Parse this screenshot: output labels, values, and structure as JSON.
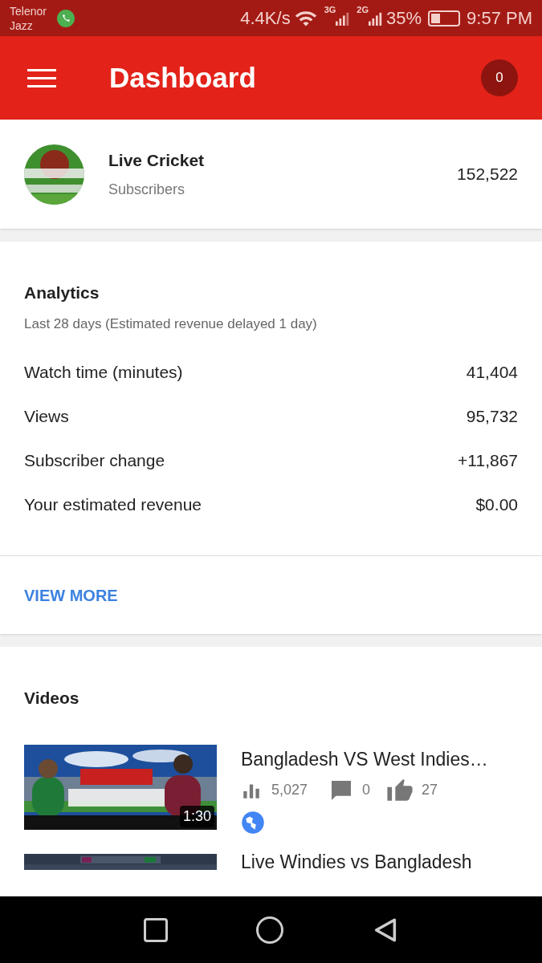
{
  "status_bar": {
    "carrier_line_1": "Telenor",
    "carrier_line_2": "Jazz",
    "speed": "4.4K/s",
    "network_1": "3G",
    "network_2": "2G",
    "battery": "35%",
    "time": "9:57 PM"
  },
  "app_bar": {
    "title": "Dashboard",
    "notification_count": "0"
  },
  "channel": {
    "name": "Live Cricket",
    "caption": "Subscribers",
    "subscribers": "152,522"
  },
  "analytics": {
    "title": "Analytics",
    "subtitle": "Last 28 days (Estimated revenue delayed 1 day)",
    "rows": [
      {
        "label": "Watch time (minutes)",
        "value": "41,404"
      },
      {
        "label": "Views",
        "value": "95,732"
      },
      {
        "label": "Subscriber change",
        "value": "+11,867"
      },
      {
        "label": "Your estimated revenue",
        "value": "$0.00"
      }
    ],
    "action": "VIEW MORE"
  },
  "videos": {
    "title": "Videos",
    "items": [
      {
        "title": "Bangladesh VS West Indies…",
        "duration": "1:30",
        "views": "5,027",
        "comments": "0",
        "likes": "27",
        "public": true
      },
      {
        "title": "Live Windies vs Bangladesh"
      }
    ]
  }
}
